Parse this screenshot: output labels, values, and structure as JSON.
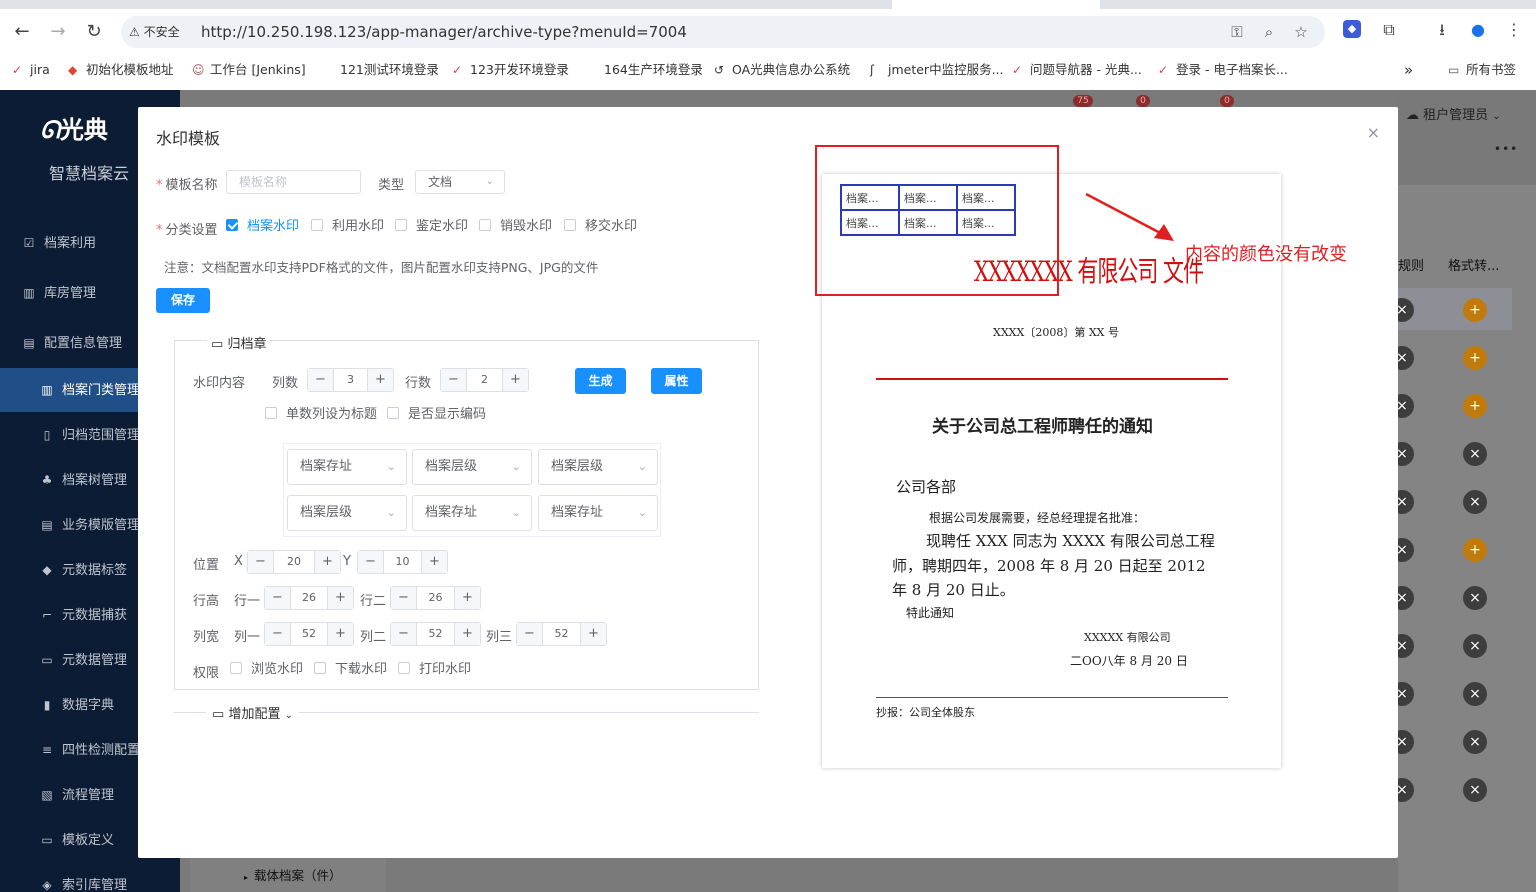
{
  "browser": {
    "security_label": "不安全",
    "url": "http://10.250.198.123/app-manager/archive-type?menuId=7004",
    "bookmarks": [
      "jira",
      "初始化模板地址",
      "工作台 [Jenkins]",
      "121测试环境登录",
      "123开发环境登录",
      "164生产环境登录",
      "OA光典信息办公系统",
      "jmeter中监控服务...",
      "问题导航器 - 光典...",
      "登录 - 电子档案长..."
    ],
    "all_bookmarks": "所有书签",
    "overflow": "»"
  },
  "sidebar": {
    "logo": "光典",
    "subtitle": "智慧档案云",
    "items": [
      {
        "label": "档案利用",
        "icon": "☑"
      },
      {
        "label": "库房管理",
        "icon": "▥"
      },
      {
        "label": "配置信息管理",
        "icon": "▤"
      },
      {
        "label": "档案门类管理",
        "icon": "▥"
      },
      {
        "label": "归档范围管理",
        "icon": "▯"
      },
      {
        "label": "档案树管理",
        "icon": "♣"
      },
      {
        "label": "业务模版管理",
        "icon": "▤"
      },
      {
        "label": "元数据标签",
        "icon": "◆"
      },
      {
        "label": "元数据捕获",
        "icon": "⌐"
      },
      {
        "label": "元数据管理",
        "icon": "▭"
      },
      {
        "label": "数据字典",
        "icon": "▮"
      },
      {
        "label": "四性检测配置",
        "icon": "≡"
      },
      {
        "label": "流程管理",
        "icon": "▧"
      },
      {
        "label": "模板定义",
        "icon": "▭"
      },
      {
        "label": "索引库管理",
        "icon": "◈"
      }
    ]
  },
  "background": {
    "user": "租户管理员",
    "badges": [
      "75",
      "0",
      "0"
    ],
    "more": "•••",
    "col1": "规则",
    "col2": "格式转...",
    "tree_item": "载体档案（件）"
  },
  "modal": {
    "title": "水印模板",
    "close": "×",
    "name_label": "模板名称",
    "name_placeholder": "模板名称",
    "type_label": "类型",
    "type_value": "文档",
    "category_label": "分类设置",
    "categories": [
      "档案水印",
      "利用水印",
      "鉴定水印",
      "销毁水印",
      "移交水印"
    ],
    "note": "注意：文档配置水印支持PDF格式的文件，图片配置水印支持PNG、JPG的文件",
    "save": "保存",
    "archive_section": "归档章",
    "content_label": "水印内容",
    "cols_label": "列数",
    "cols_value": "3",
    "rows_label": "行数",
    "rows_value": "2",
    "generate": "生成",
    "property": "属性",
    "odd_col_title": "单数列设为标题",
    "show_code": "是否显示编码",
    "grid": [
      "档案存址",
      "档案层级",
      "档案层级",
      "档案层级",
      "档案存址",
      "档案存址"
    ],
    "position_label": "位置",
    "x_label": "X",
    "x_value": "20",
    "y_label": "Y",
    "y_value": "10",
    "row_height_label": "行高",
    "row1_label": "行一",
    "row1_value": "26",
    "row2_label": "行二",
    "row2_value": "26",
    "col_width_label": "列宽",
    "col1_label": "列一",
    "col1_value": "52",
    "col2_label": "列二",
    "col2_value": "52",
    "col3_label": "列三",
    "col3_value": "52",
    "permission_label": "权限",
    "permissions": [
      "浏览水印",
      "下载水印",
      "打印水印"
    ],
    "add_config": "增加配置",
    "minus": "−",
    "plus": "+"
  },
  "preview": {
    "watermark_cells": [
      "档案...",
      "档案...",
      "档案...",
      "档案...",
      "档案...",
      "档案..."
    ],
    "stamp_text": "XXXXXXX 有限公司 文件",
    "doc_no": "XXXX〔2008〕第 XX 号",
    "title": "关于公司总工程师聘任的通知",
    "salutation": "公司各部",
    "line1": "根据公司发展需要，经总经理提名批准：",
    "line2": "现聘任 XXX 同志为 XXXX 有限公司总工程",
    "line3": "师，聘期四年，2008 年 8 月 20 日起至 2012",
    "line4": "年 8 月 20 日止。",
    "line5": "特此通知",
    "signer": "XXXXX 有限公司",
    "date": "二OO八年 8 月 20 日",
    "cc": "抄报：公司全体股东"
  },
  "annotation": {
    "text": "内容的颜色没有改变",
    "color": "#e02020"
  }
}
